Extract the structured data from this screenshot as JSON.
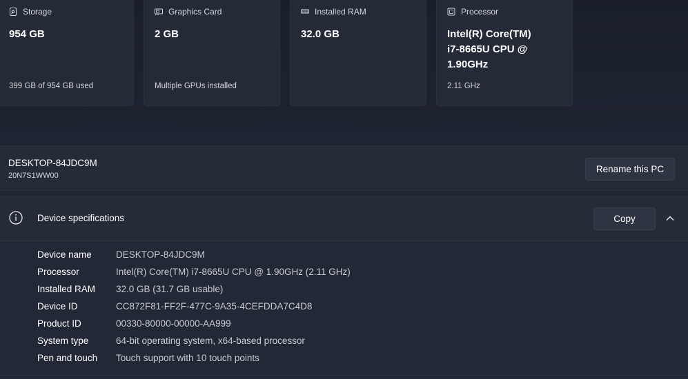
{
  "cards": [
    {
      "title": "Storage",
      "icon": "storage-icon",
      "value": "954 GB",
      "sub": "399 GB of 954 GB used"
    },
    {
      "title": "Graphics Card",
      "icon": "graphics-card-icon",
      "value": "2 GB",
      "sub": "Multiple GPUs installed"
    },
    {
      "title": "Installed RAM",
      "icon": "ram-icon",
      "value": "32.0 GB",
      "sub": ""
    },
    {
      "title": "Processor",
      "icon": "processor-icon",
      "value": "Intel(R) Core(TM) i7-8665U CPU @ 1.90GHz",
      "sub": "2.11 GHz"
    }
  ],
  "pc": {
    "name": "DESKTOP-84JDC9M",
    "model": "20N7S1WW00",
    "rename_label": "Rename this PC"
  },
  "specs": {
    "title": "Device specifications",
    "copy_label": "Copy",
    "rows": [
      {
        "label": "Device name",
        "value": "DESKTOP-84JDC9M"
      },
      {
        "label": "Processor",
        "value": "Intel(R) Core(TM) i7-8665U CPU @ 1.90GHz (2.11 GHz)"
      },
      {
        "label": "Installed RAM",
        "value": "32.0 GB (31.7 GB usable)"
      },
      {
        "label": "Device ID",
        "value": "CC872F81-FF2F-477C-9A35-4CEFDDA7C4D8"
      },
      {
        "label": "Product ID",
        "value": "00330-80000-00000-AA999"
      },
      {
        "label": "System type",
        "value": "64-bit operating system, x64-based processor"
      },
      {
        "label": "Pen and touch",
        "value": "Touch support with 10 touch points"
      }
    ]
  },
  "colors": {
    "background": "#1e2330",
    "card": "#252a37",
    "button": "#2f3443"
  }
}
